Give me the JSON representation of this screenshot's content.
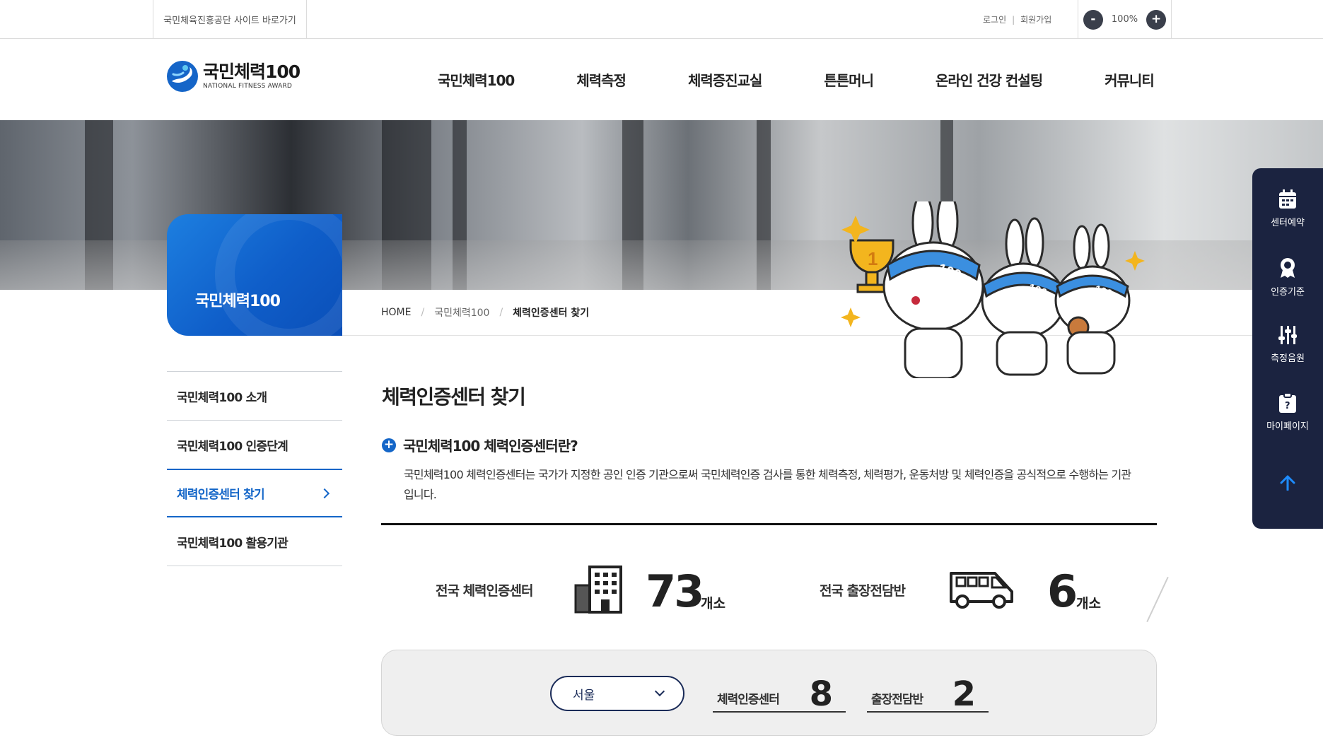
{
  "topbar": {
    "site_link": "국민체육진흥공단 사이트 바로가기",
    "login": "로그인",
    "separator": "|",
    "signup": "회원가입",
    "zoom_minus": "-",
    "zoom_level": "100%",
    "zoom_plus": "+"
  },
  "logo": {
    "ko": "국민체력100",
    "en": "NATIONAL FITNESS AWARD"
  },
  "gnb": [
    "국민체력100",
    "체력측정",
    "체력증진교실",
    "튼튼머니",
    "온라인 건강 컨설팅",
    "커뮤니티"
  ],
  "side": {
    "title": "국민체력100",
    "items": [
      {
        "label": "국민체력100 소개"
      },
      {
        "label": "국민체력100 인증단계"
      },
      {
        "label": "체력인증센터 찾기",
        "active": true
      },
      {
        "label": "국민체력100 활용기관"
      }
    ]
  },
  "breadcrumb": {
    "home": "HOME",
    "level1": "국민체력100",
    "current": "체력인증센터 찾기"
  },
  "main": {
    "title": "체력인증센터 찾기",
    "section_title": "국민체력100 체력인증센터란?",
    "section_desc": "국민체력100 체력인증센터는 국가가 지정한 공인 인증 기관으로써 국민체력인증 검사를 통한 체력측정, 체력평가, 운동처방 및 체력인증을 공식적으로 수행하는 기관입니다."
  },
  "stats": {
    "centers_label": "전국 체력인증센터",
    "centers_count": "73",
    "centers_unit": "개소",
    "mobile_label": "전국 출장전담반",
    "mobile_count": "6",
    "mobile_unit": "개소"
  },
  "region": {
    "selected": "서울",
    "center_label": "체력인증센터",
    "center_count": "8",
    "mobile_label": "출장전담반",
    "mobile_count": "2"
  },
  "quick_menu": [
    {
      "label": "센터예약",
      "icon": "calendar-icon"
    },
    {
      "label": "인증기준",
      "icon": "badge-icon"
    },
    {
      "label": "측정음원",
      "icon": "sliders-icon"
    },
    {
      "label": "마이페이지",
      "icon": "clipboard-icon"
    }
  ],
  "colors": {
    "primary_blue": "#1466c8",
    "navy": "#1b2340"
  }
}
